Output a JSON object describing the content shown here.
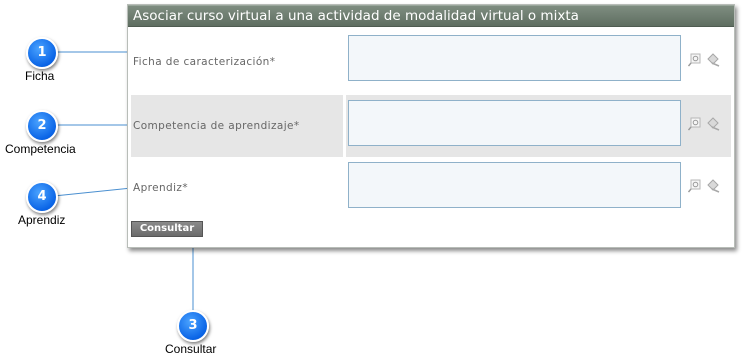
{
  "panel": {
    "title": "Asociar curso virtual a una actividad de modalidad virtual o mixta",
    "fields": [
      {
        "label": "Ficha de caracterización*",
        "value": ""
      },
      {
        "label": "Competencia de aprendizaje*",
        "value": ""
      },
      {
        "label": "Aprendiz*",
        "value": ""
      }
    ],
    "icons": [
      "search-icon",
      "clear-icon"
    ],
    "submit_label": "Consultar"
  },
  "callouts": [
    {
      "number": "1",
      "label": "Ficha"
    },
    {
      "number": "2",
      "label": "Competencia"
    },
    {
      "number": "4",
      "label": "Aprendiz"
    },
    {
      "number": "3",
      "label": "Consultar"
    }
  ],
  "colors": {
    "title_bar": "#6f7e71",
    "alt_row": "#e6e6e6",
    "input_border": "#8fb1c9",
    "badge": "#1a78f0",
    "callout_line": "#4a8fd0"
  }
}
